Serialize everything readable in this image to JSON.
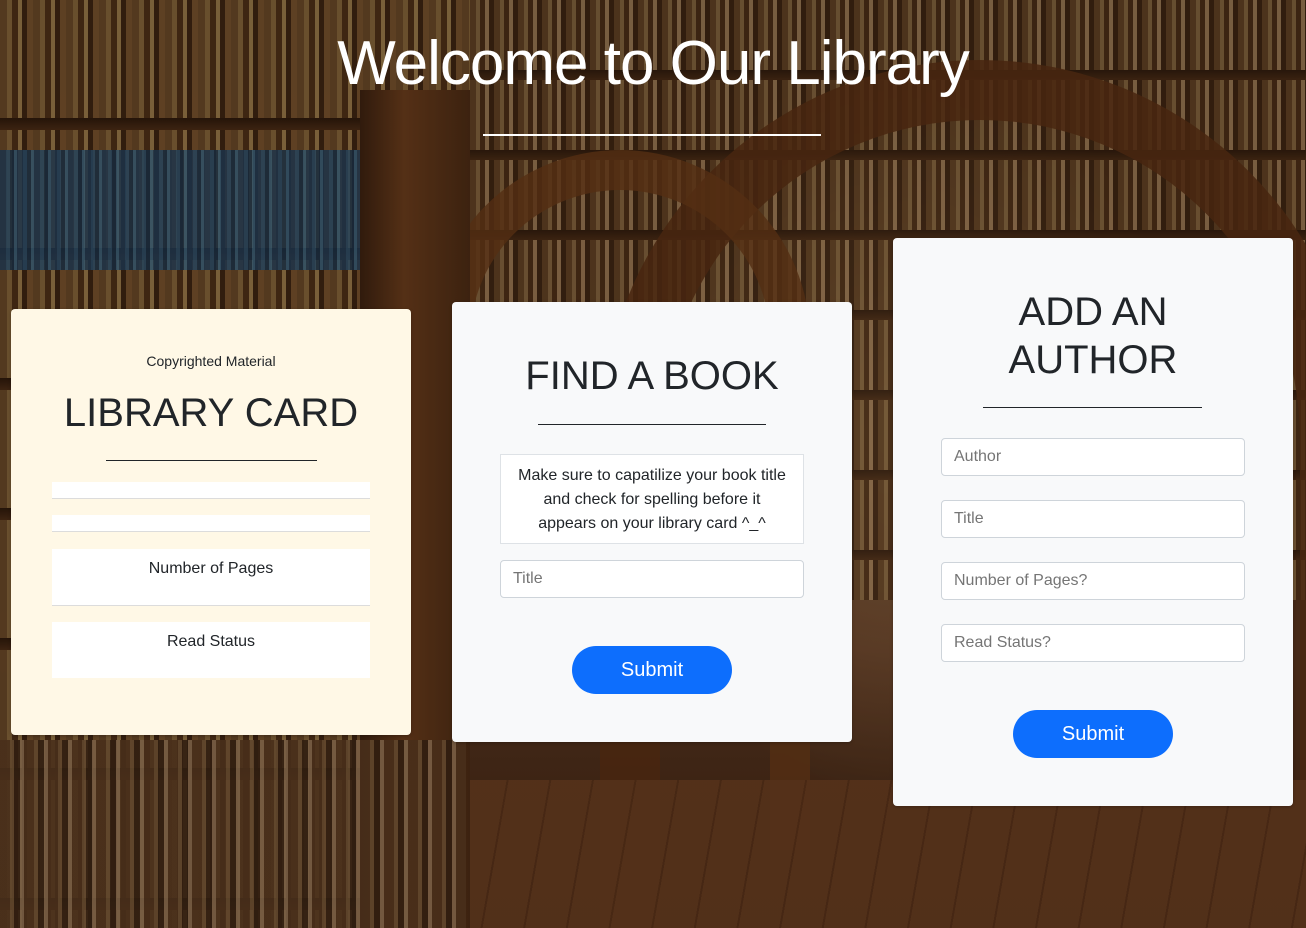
{
  "page": {
    "title": "Welcome to Our Library"
  },
  "library_card": {
    "copyright": "Copyrighted Material",
    "heading": "LIBRARY CARD",
    "rows": [
      "",
      "",
      "Number of Pages",
      "Read Status"
    ]
  },
  "find_book": {
    "heading": "FIND A BOOK",
    "note": "Make sure to capatilize your book title and check for spelling before it appears on your library card ^_^",
    "title_placeholder": "Title",
    "submit_label": "Submit"
  },
  "add_author": {
    "heading_line1": "ADD AN",
    "heading_line2": "AUTHOR",
    "author_placeholder": "Author",
    "title_placeholder": "Title",
    "pages_placeholder": "Number of Pages?",
    "status_placeholder": "Read Status?",
    "submit_label": "Submit"
  },
  "colors": {
    "primary_button": "#0d6efd",
    "library_card_bg": "#fff8e6",
    "form_card_bg": "#f8f9fa"
  }
}
